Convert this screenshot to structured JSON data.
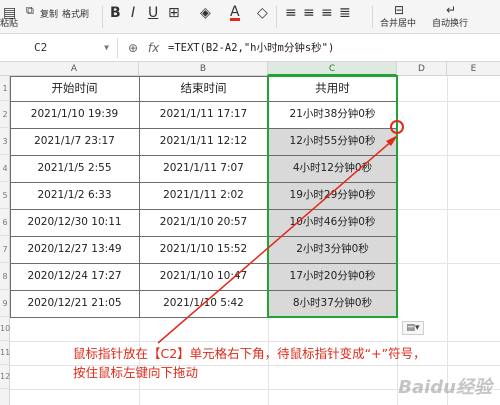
{
  "toolbar": {
    "paste_label": "粘贴",
    "copy_label": "复制",
    "format_painter_label": "格式刷",
    "bold_icon": "B",
    "italic_icon": "I",
    "underline_icon": "U",
    "merge_center_label": "合并居中",
    "auto_wrap_label": "自动换行"
  },
  "formula_bar": {
    "name_box": "C2",
    "fx_label": "fx",
    "formula": "=TEXT(B2-A2,\"h小时m分钟s秒\")"
  },
  "columns": [
    "A",
    "B",
    "C",
    "D",
    "E"
  ],
  "rows": [
    "1",
    "2",
    "3",
    "4",
    "5",
    "6",
    "7",
    "8",
    "9",
    "10",
    "11",
    "12"
  ],
  "table": {
    "headers": [
      "开始时间",
      "结束时间",
      "共用时"
    ],
    "data": [
      [
        "2021/1/10 19:39",
        "2021/1/11 17:17",
        "21小时38分钟0秒"
      ],
      [
        "2021/1/7 23:17",
        "2021/1/11 12:12",
        "12小时55分钟0秒"
      ],
      [
        "2021/1/5 2:55",
        "2021/1/11 7:07",
        "4小时12分钟0秒"
      ],
      [
        "2021/1/2 6:33",
        "2021/1/11 2:02",
        "19小时29分钟0秒"
      ],
      [
        "2020/12/30 10:11",
        "2021/1/10 20:57",
        "10小时46分钟0秒"
      ],
      [
        "2020/12/27 13:49",
        "2021/1/10 15:52",
        "2小时3分钟0秒"
      ],
      [
        "2020/12/24 17:27",
        "2021/1/10 10:47",
        "17小时20分钟0秒"
      ],
      [
        "2020/12/21 21:05",
        "2021/1/10 5:42",
        "8小时37分钟0秒"
      ]
    ]
  },
  "annotation": {
    "text": "鼠标指针放在【C2】单元格右下角，待鼠标指针变成“+”符号，按住鼠标左键向下拖动",
    "color": "#e22a1a"
  },
  "watermark": "Baidu经验",
  "colors": {
    "selection_green": "#21a336",
    "shade": "#d9d9d9",
    "accent_red": "#e22a1a"
  }
}
